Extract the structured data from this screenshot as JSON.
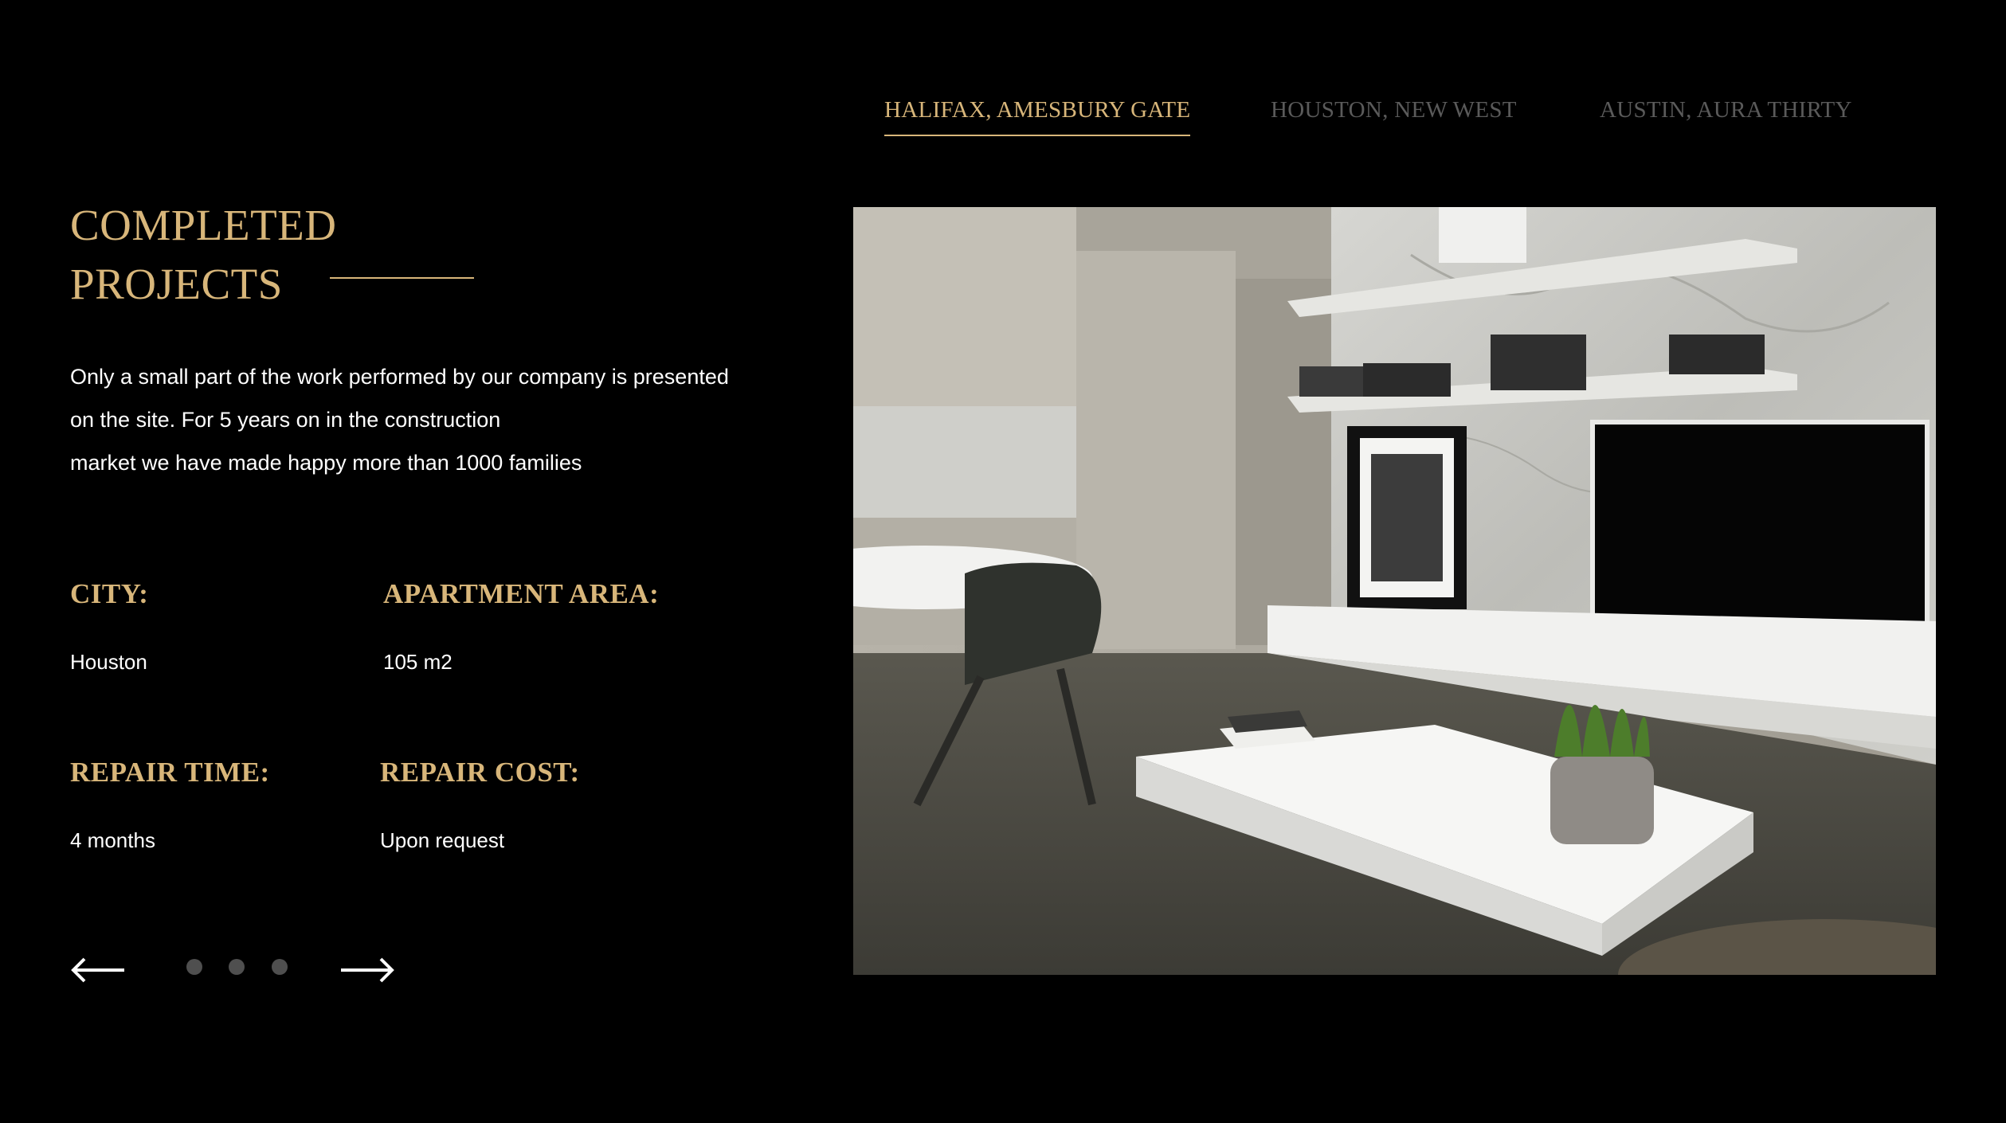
{
  "tabs": [
    {
      "label": "HALIFAX, AMESBURY GATE",
      "active": true
    },
    {
      "label": "HOUSTON, NEW WEST",
      "active": false
    },
    {
      "label": "AUSTIN, AURA THIRTY",
      "active": false
    }
  ],
  "heading": {
    "line1": "COMPLETED",
    "line2": "PROJECTS"
  },
  "description": {
    "line1": "Only a small part of the work performed by our company is presented",
    "line2": "on the site. For 5 years on in the construction",
    "line3": "market we have made happy more than 1000 families"
  },
  "info": {
    "city": {
      "label": "CITY:",
      "value": "Houston"
    },
    "area": {
      "label": "APARTMENT AREA:",
      "value": "105 m2"
    },
    "repair_time": {
      "label": "REPAIR TIME:",
      "value": "4 months"
    },
    "repair_cost": {
      "label": "REPAIR COST:",
      "value": "Upon request"
    }
  },
  "slider": {
    "prev_icon": "arrow-left-icon",
    "next_icon": "arrow-right-icon",
    "dot_count": 3
  },
  "photo": {
    "subject": "living room interior photo"
  },
  "colors": {
    "background": "#000000",
    "accent_gold": "#d8b67a",
    "text": "#ffffff",
    "inactive_tab": "#5a5a5a",
    "dot": "#4f4f4f"
  }
}
